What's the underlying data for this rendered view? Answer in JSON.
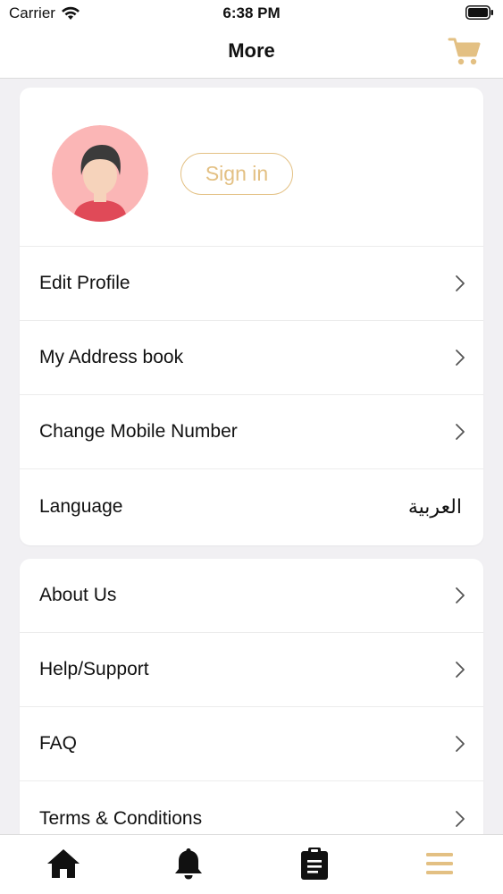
{
  "status_bar": {
    "carrier": "Carrier",
    "time": "6:38 PM"
  },
  "nav": {
    "title": "More"
  },
  "profile": {
    "sign_in_label": "Sign in"
  },
  "account_menu": [
    {
      "label": "Edit Profile"
    },
    {
      "label": "My Address book"
    },
    {
      "label": "Change Mobile Number"
    }
  ],
  "language": {
    "label": "Language",
    "value": "العربية"
  },
  "info_menu": [
    {
      "label": "About Us"
    },
    {
      "label": "Help/Support"
    },
    {
      "label": "FAQ"
    },
    {
      "label": "Terms & Conditions"
    }
  ],
  "tabs": [
    "home-icon",
    "bell-icon",
    "clipboard-icon",
    "menu-icon"
  ],
  "colors": {
    "accent": "#e3c083",
    "background": "#f1f0f3",
    "avatar_bg": "#fbb6b6"
  }
}
